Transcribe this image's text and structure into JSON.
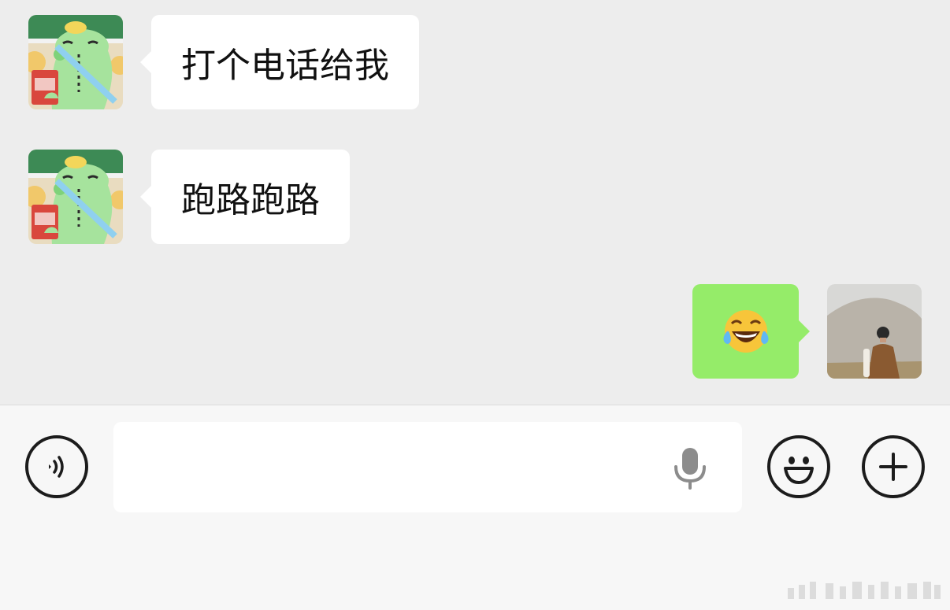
{
  "messages": [
    {
      "direction": "incoming",
      "sender": "contact",
      "text": "打个电话给我"
    },
    {
      "direction": "incoming",
      "sender": "contact",
      "text": "跑路跑路"
    },
    {
      "direction": "outgoing",
      "sender": "me",
      "text": "😂",
      "emoji_name": "face-with-tears-of-joy"
    }
  ],
  "input_bar": {
    "value": "",
    "placeholder": "",
    "icons": [
      "voice-toggle-icon",
      "microphone-icon",
      "emoji-icon",
      "plus-icon"
    ]
  },
  "colors": {
    "chat_background": "#ededed",
    "incoming_bubble": "#ffffff",
    "outgoing_bubble": "#95ec69",
    "input_panel": "#f7f7f7",
    "icon_stroke": "#1c1c1c"
  }
}
